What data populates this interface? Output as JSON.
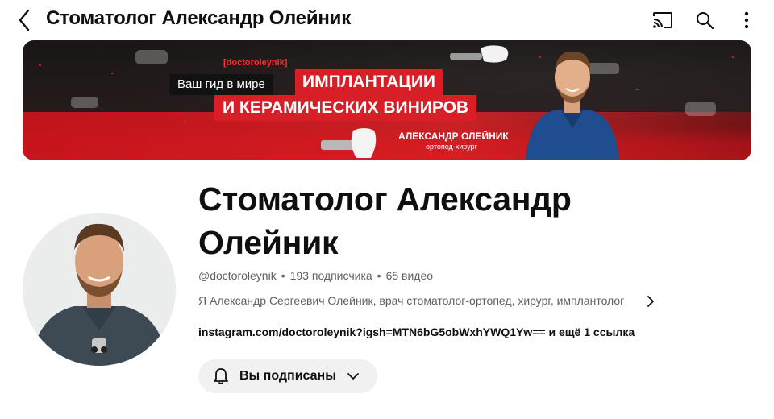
{
  "header": {
    "title": "Стоматолог Александр Олейник",
    "icons": [
      "back-icon",
      "cast-icon",
      "search-icon",
      "more-vertical-icon"
    ]
  },
  "banner": {
    "tag": "[doctoroleynik]",
    "guide_text": "Ваш гид в мире",
    "highlight_1": "ИМПЛАНТАЦИИ",
    "highlight_2": "И КЕРАМИЧЕСКИХ ВИНИРОВ",
    "name": "АЛЕКСАНДР ОЛЕЙНИК",
    "role": "ортопед-хирург",
    "colors": {
      "accent": "#d81e26",
      "dark": "#1a1616"
    }
  },
  "channel": {
    "name": "Стоматолог Александр Олейник",
    "handle": "@doctoroleynik",
    "subscribers": "193 подписчика",
    "videos": "65 видео",
    "description": "Я Александр Сергеевич Олейник, врач стоматолог-ортопед, хирург, имплантолог",
    "links": "instagram.com/doctoroleynik?igsh=MTN6bG5obWxhYWQ1Yw== и ещё 1 ссылка",
    "subscribe_label": "Вы подписаны"
  }
}
